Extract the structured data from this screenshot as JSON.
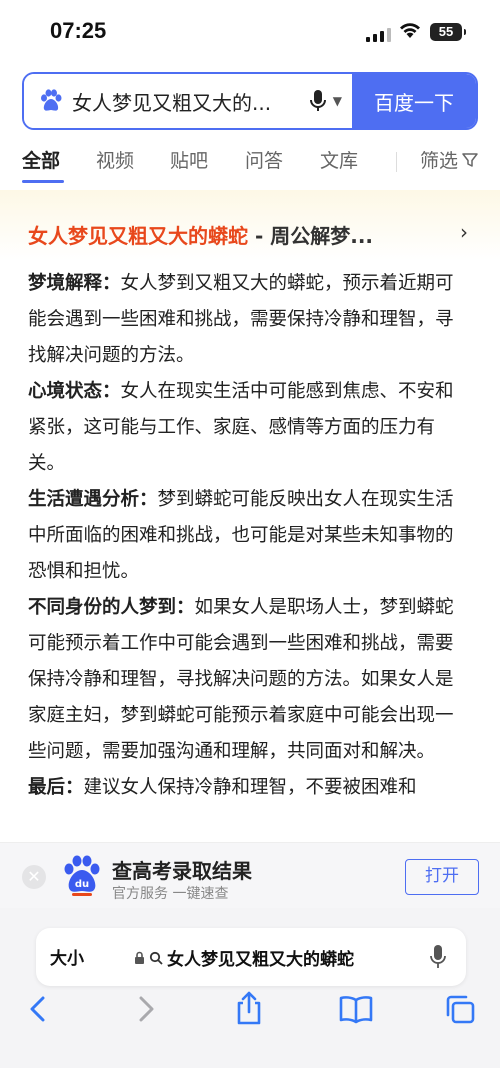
{
  "status_bar": {
    "time": "07:25",
    "battery": "55"
  },
  "search": {
    "query": "女人梦见又粗又大的...",
    "submit_label": "百度一下"
  },
  "tabs": [
    {
      "label": "全部",
      "active": true
    },
    {
      "label": "视频"
    },
    {
      "label": "贴吧"
    },
    {
      "label": "问答"
    },
    {
      "label": "文库"
    }
  ],
  "filter_label": "筛选",
  "result": {
    "title_highlight": "女人梦见又粗又大的蟒蛇",
    "title_rest": " - 周公解梦...",
    "paragraphs": [
      {
        "label": "梦境解释：",
        "text": "女人梦到又粗又大的蟒蛇，预示着近期可能会遇到一些困难和挑战，需要保持冷静和理智，寻找解决问题的方法。"
      },
      {
        "label": "心境状态：",
        "text": "女人在现实生活中可能感到焦虑、不安和紧张，这可能与工作、家庭、感情等方面的压力有关。"
      },
      {
        "label": "生活遭遇分析：",
        "text": "梦到蟒蛇可能反映出女人在现实生活中所面临的困难和挑战，也可能是对某些未知事物的恐惧和担忧。"
      },
      {
        "label": "不同身份的人梦到：",
        "text": "如果女人是职场人士，梦到蟒蛇可能预示着工作中可能会遇到一些困难和挑战，需要保持冷静和理智，寻找解决问题的方法。如果女人是家庭主妇，梦到蟒蛇可能预示着家庭中可能会出现一些问题，需要加强沟通和理解，共同面对和解决。"
      },
      {
        "label": "最后：",
        "text": "建议女人保持冷静和理智，不要被困难和"
      }
    ]
  },
  "app_banner": {
    "title": "查高考录取结果",
    "subtitle": "官方服务 一键速查",
    "open_label": "打开"
  },
  "browser": {
    "text_size_label": "大小",
    "url_text": "女人梦见又粗又大的蟒蛇"
  },
  "colors": {
    "accent": "#4e6ef2",
    "title_red": "#e8481c"
  }
}
